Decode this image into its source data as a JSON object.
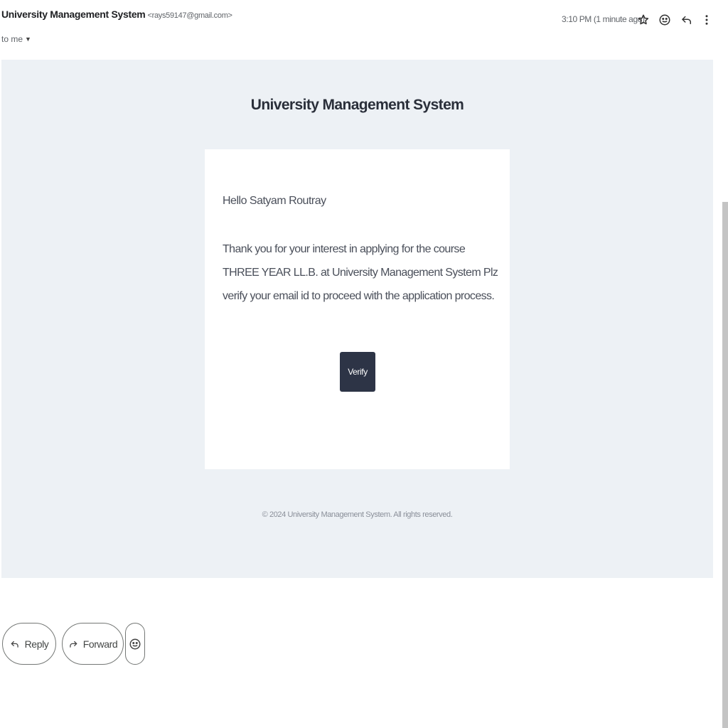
{
  "header": {
    "sender_name": "University Management System",
    "sender_email": "<rays59147@gmail.com>",
    "recipient": "to me",
    "timestamp": "3:10 PM (1 minute ago)",
    "icons": [
      "star-icon",
      "emoji-icon",
      "reply-icon",
      "more-vert-icon"
    ]
  },
  "email": {
    "heading": "University Management System",
    "greeting": "Hello Satyam Routray",
    "body": "Thank you for your interest in applying for the course THREE YEAR LL.B. at University Management System Plz verify your email id to proceed with the application process.",
    "verify_label": "Verify",
    "footer": "© 2024 University Management System. All rights reserved.",
    "colors": {
      "frame_background": "#edf1f5",
      "card_background": "#ffffff",
      "button_background": "#2d3446"
    }
  },
  "actions": {
    "reply_label": "Reply",
    "forward_label": "Forward",
    "icons": [
      "reply-icon",
      "forward-icon",
      "emoji-icon"
    ]
  }
}
